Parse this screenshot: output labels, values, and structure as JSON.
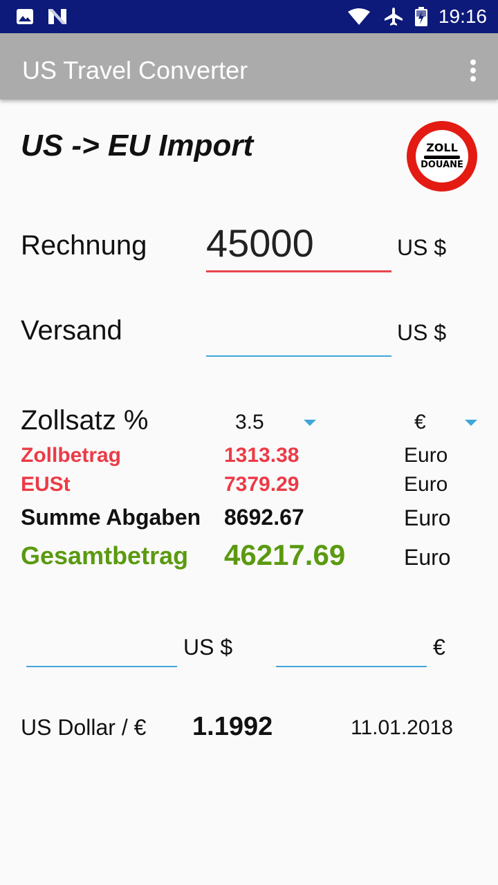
{
  "status_bar": {
    "time": "19:16",
    "icons": [
      "image-icon",
      "n-notification-icon",
      "wifi-icon",
      "airplane-mode-icon",
      "battery-charging-icon"
    ]
  },
  "app_bar": {
    "title": "US Travel Converter",
    "menu_icon": "overflow-menu-icon"
  },
  "main": {
    "heading": "US -> EU Import",
    "customs_sign": {
      "line1": "ZOLL",
      "line2": "DOUANE"
    },
    "invoice": {
      "label": "Rechnung",
      "value": "45000",
      "unit": "US $"
    },
    "shipping": {
      "label": "Versand",
      "value": "",
      "unit": "US $"
    },
    "duty_rate": {
      "label": "Zollsatz %",
      "rate_selected": "3.5",
      "currency_selected": "€"
    },
    "results": {
      "duty_amount": {
        "label": "Zollbetrag",
        "value": "1313.38",
        "unit": "Euro"
      },
      "import_vat": {
        "label": "EUSt",
        "value": "7379.29",
        "unit": "Euro"
      },
      "total_levies": {
        "label": "Summe Abgaben",
        "value": "8692.67",
        "unit": "Euro"
      },
      "grand_total": {
        "label": "Gesamtbetrag",
        "value": "46217.69",
        "unit": "Euro"
      }
    },
    "converter": {
      "usd_value": "",
      "usd_unit": "US $",
      "eur_value": "",
      "eur_unit": "€"
    },
    "exchange": {
      "label": "US Dollar / €",
      "rate": "1.1992",
      "date": "11.01.2018"
    }
  },
  "colors": {
    "status_bar": "#0d1a7a",
    "app_bar": "#ababab",
    "accent_red": "#ec3b46",
    "accent_green": "#5a9a10",
    "accent_blue": "#3fa7d8"
  }
}
